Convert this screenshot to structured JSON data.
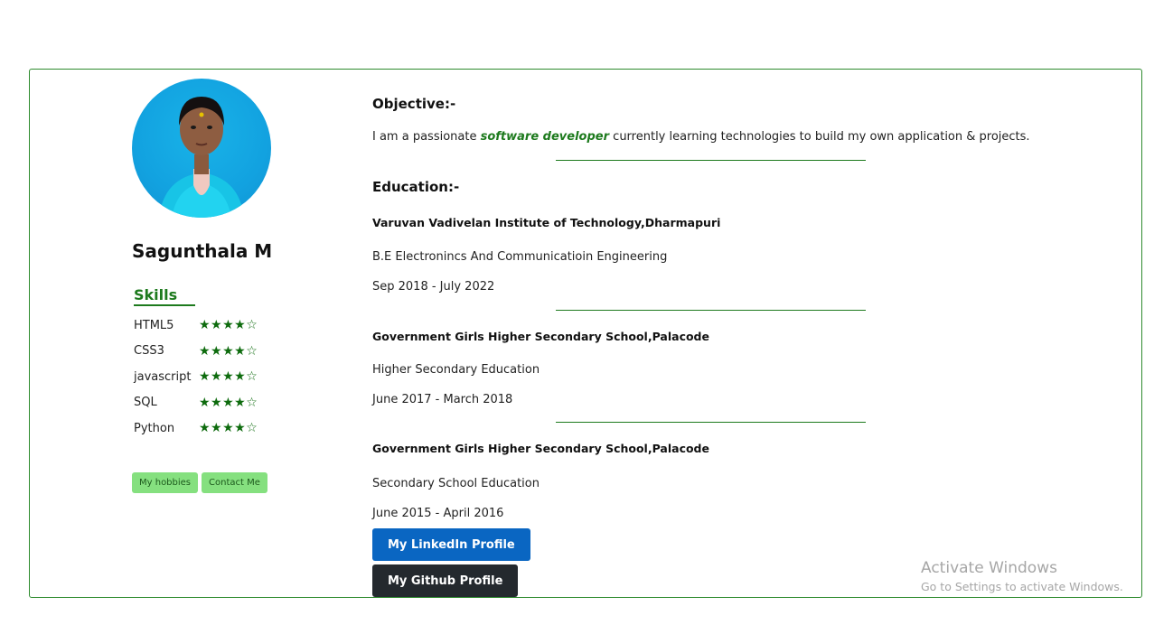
{
  "profile": {
    "name": "Sagunthala M",
    "skills_title": "Skills",
    "skills": [
      {
        "name": "HTML5",
        "stars": "★★★★☆"
      },
      {
        "name": "CSS3",
        "stars": "★★★★☆"
      },
      {
        "name": "javascript",
        "stars": "★★★★☆"
      },
      {
        "name": "SQL",
        "stars": "★★★★☆"
      },
      {
        "name": "Python",
        "stars": "★★★★☆"
      }
    ],
    "buttons": {
      "hobbies": "My hobbies",
      "contact": "Contact Me"
    }
  },
  "objective": {
    "heading": "Objective:-",
    "text_before": "I am a passionate",
    "highlight": "software developer",
    "text_after": "currently learning technologies to build my own application & projects."
  },
  "education": {
    "heading": "Education:-",
    "entries": [
      {
        "school": "Varuvan Vadivelan Institute of Technology,Dharmapuri",
        "degree": "B.E Electronincs And Communicatioin Engineering",
        "period": "Sep 2018 - July 2022"
      },
      {
        "school": "Government Girls Higher Secondary School,Palacode",
        "degree": "Higher Secondary Education",
        "period": "June 2017 - March 2018"
      },
      {
        "school": "Government Girls Higher Secondary School,Palacode",
        "degree": "Secondary School Education",
        "period": "June 2015 - April 2016"
      }
    ]
  },
  "links": {
    "linkedin": "My LinkedIn Profile",
    "github": "My Github Profile"
  },
  "watermark": {
    "line1": "Activate Windows",
    "line2": "Go to Settings to activate Windows."
  },
  "colors": {
    "accent": "#1d7a1d",
    "linkedin": "#0a66c2",
    "github": "#24292e",
    "mini_button": "#85e07f"
  }
}
